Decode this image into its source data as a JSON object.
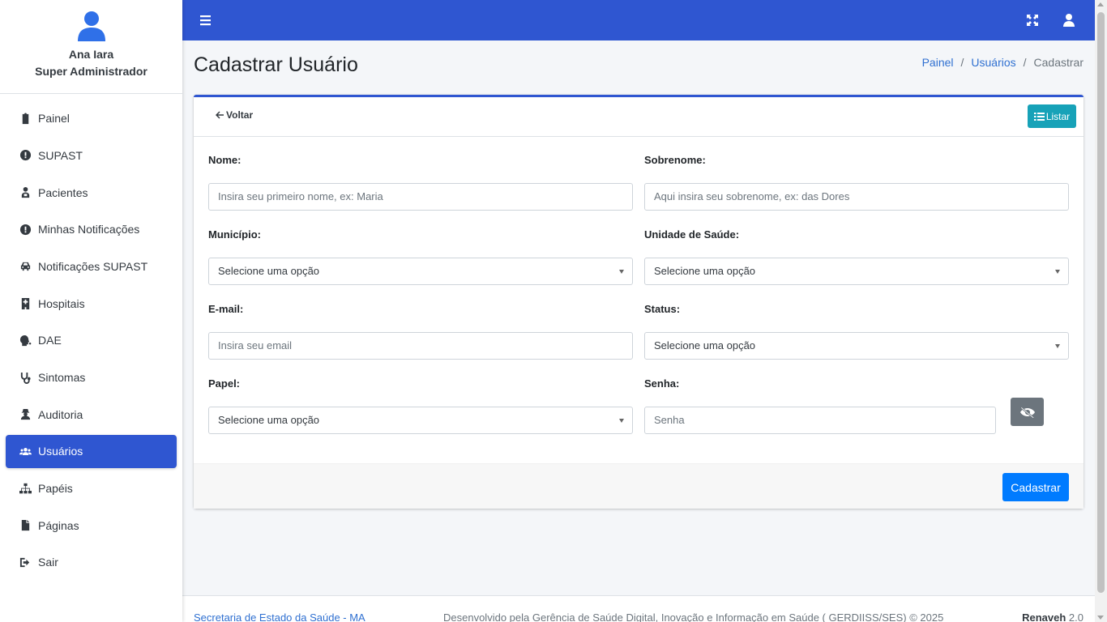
{
  "user": {
    "name": "Ana Iara",
    "role": "Super Administrador"
  },
  "sidebar": {
    "items": [
      {
        "label": "Painel",
        "icon": "clipboard-icon"
      },
      {
        "label": "SUPAST",
        "icon": "exclamation-circle-icon"
      },
      {
        "label": "Pacientes",
        "icon": "user-injured-icon"
      },
      {
        "label": "Minhas Notificações",
        "icon": "exclamation-circle-icon"
      },
      {
        "label": "Notificações SUPAST",
        "icon": "car-icon"
      },
      {
        "label": "Hospitais",
        "icon": "hospital-icon"
      },
      {
        "label": "DAE",
        "icon": "head-virus-icon"
      },
      {
        "label": "Sintomas",
        "icon": "stethoscope-icon"
      },
      {
        "label": "Auditoria",
        "icon": "user-secret-icon"
      },
      {
        "label": "Usuários",
        "icon": "users-icon",
        "active": true
      },
      {
        "label": "Papéis",
        "icon": "sitemap-icon"
      },
      {
        "label": "Páginas",
        "icon": "file-icon"
      },
      {
        "label": "Sair",
        "icon": "sign-out-icon"
      }
    ]
  },
  "page": {
    "title": "Cadastrar Usuário"
  },
  "breadcrumb": {
    "home": "Painel",
    "section": "Usuários",
    "current": "Cadastrar",
    "separator": "/"
  },
  "card": {
    "back_label": "Voltar",
    "list_label": "Listar",
    "submit_label": "Cadastrar"
  },
  "form": {
    "nome": {
      "label": "Nome:",
      "placeholder": "Insira seu primeiro nome, ex: Maria"
    },
    "sobrenome": {
      "label": "Sobrenome:",
      "placeholder": "Aqui insira seu sobrenome, ex: das Dores"
    },
    "municipio": {
      "label": "Município:",
      "value": "Selecione uma opção"
    },
    "unidade": {
      "label": "Unidade de Saúde:",
      "value": "Selecione uma opção"
    },
    "email": {
      "label": "E-mail:",
      "placeholder": "Insira seu email"
    },
    "status": {
      "label": "Status:",
      "value": "Selecione uma opção"
    },
    "papel": {
      "label": "Papel:",
      "value": "Selecione uma opção"
    },
    "senha": {
      "label": "Senha:",
      "placeholder": "Senha"
    }
  },
  "footer": {
    "left": "Secretaria de Estado da Saúde - MA",
    "middle": "Desenvolvido pela Gerência de Saúde Digital, Inovação e Informação em Saúde ( GERDIISS/SES) © 2025",
    "brand": "Renaveh",
    "version": "2.0"
  },
  "colors": {
    "primary": "#2f56d1",
    "info": "#17a2b8",
    "submit": "#007bff",
    "secondary": "#6c757d"
  }
}
